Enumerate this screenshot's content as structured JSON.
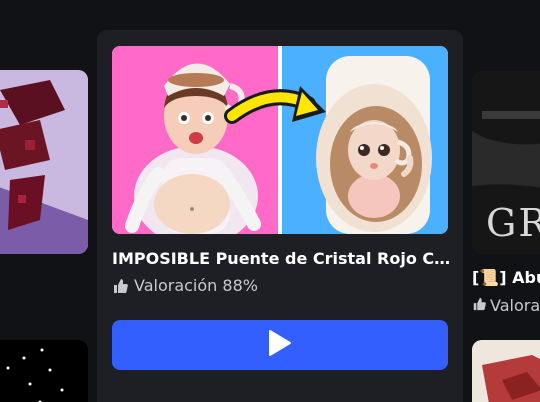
{
  "center_card": {
    "title": "IMPOSIBLE Puente de Cristal Rojo Cerebro",
    "rating_label": "Valoración 88%",
    "play_icon": "play-icon",
    "rating_icon": "thumbs-up-icon"
  },
  "right_card": {
    "title": "[📜] Abu",
    "rating_label": "Valora",
    "thumbnail_text": "GRA"
  },
  "colors": {
    "background": "#111216",
    "card_background": "#1d1f25",
    "play_button": "#335fff",
    "title_text": "#ffffff",
    "secondary_text": "#c8c9cd"
  }
}
